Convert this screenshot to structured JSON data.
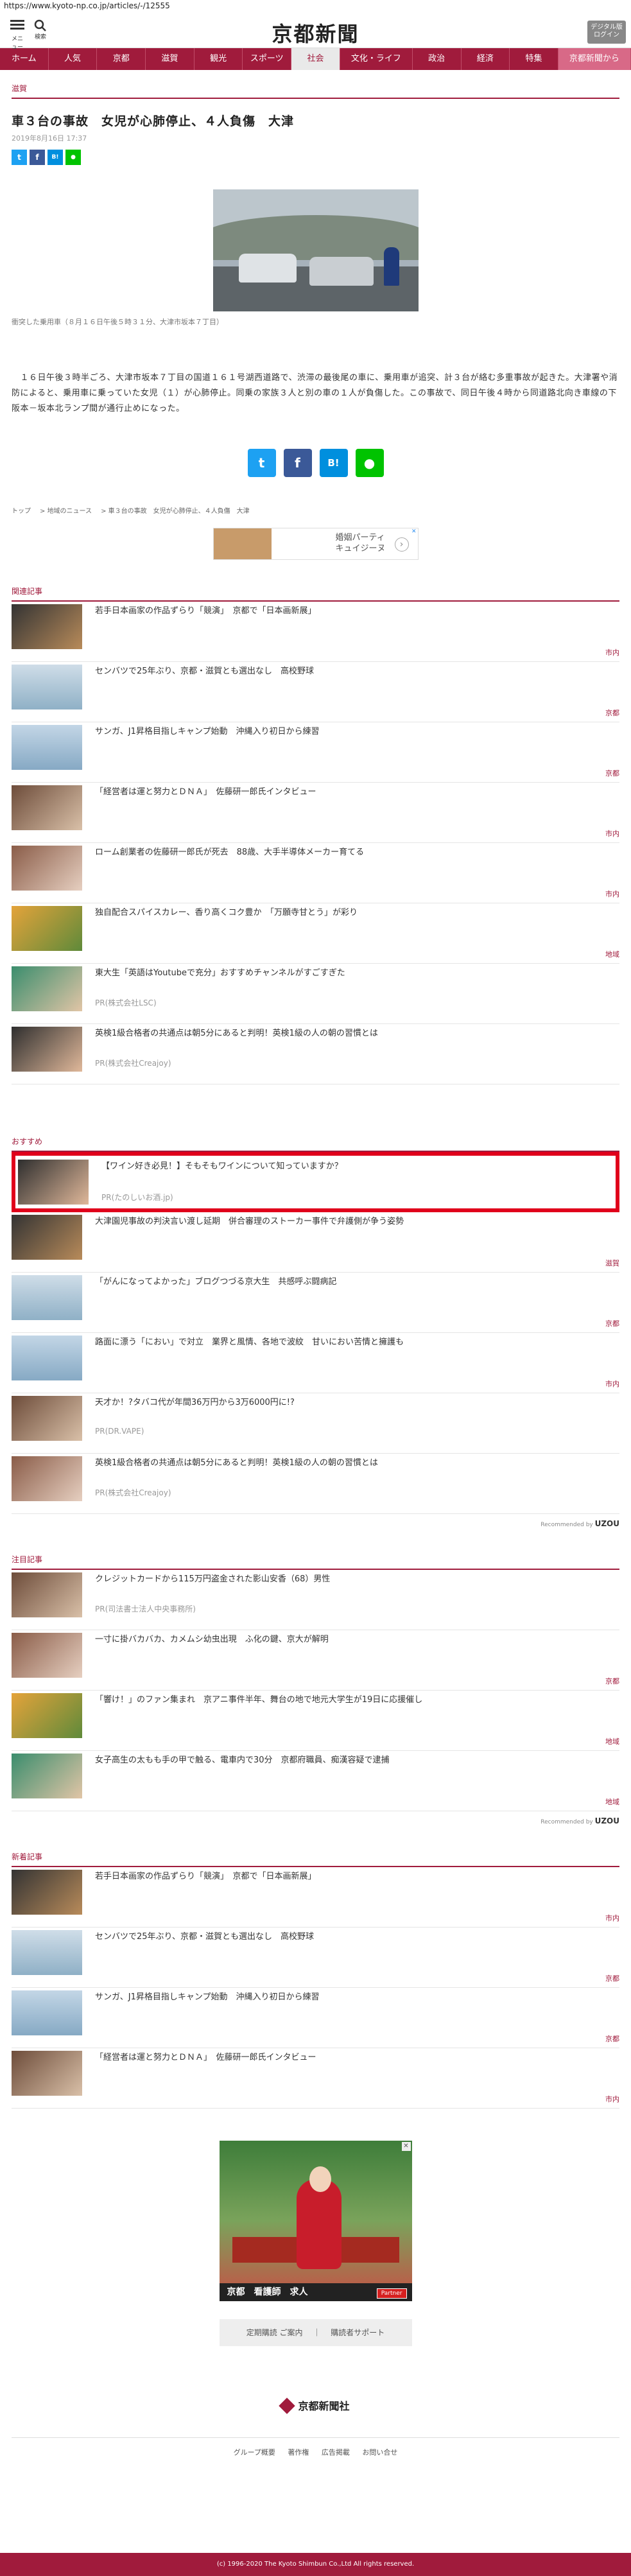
{
  "browser": {
    "url": "https://www.kyoto-np.co.jp/articles/-/12555"
  },
  "header": {
    "menu_label": "メニュー",
    "search_label": "検索",
    "logo": "京都新聞",
    "digital_btn": "デジタル版\nログイン"
  },
  "nav": [
    "ホーム",
    "人気",
    "京都",
    "滋賀",
    "観光",
    "スポーツ",
    "社会",
    "文化・ライフ",
    "政治",
    "経済",
    "特集",
    "京都新聞から"
  ],
  "article": {
    "section": "滋賀",
    "title": "車３台の事故　女児が心肺停止、４人負傷　大津",
    "date": "2019年8月16日 17:37",
    "caption": "衝突した乗用車（８月１６日午後５時３１分、大津市坂本７丁目）",
    "body": "　１６日午後３時半ごろ、大津市坂本７丁目の国道１６１号湖西道路で、渋滞の最後尾の車に、乗用車が追突、計３台が絡む多重事故が起きた。大津署や消防によると、乗用車に乗っていた女児（１）が心肺停止。同乗の家族３人と別の車の１人が負傷した。この事故で、同日午後４時から同道路北向き車線の下阪本－坂本北ランプ間が通行止めになった。"
  },
  "breadcrumb": [
    "トップ",
    "地域のニュース",
    "車３台の事故　女児が心肺停止、４人負傷　大津"
  ],
  "ad_small": {
    "text_line1": "婚姻パーティ",
    "text_line2": "キュイジーヌ"
  },
  "related": {
    "heading": "関連記事",
    "items": [
      {
        "title": "若手日本画家の作品ずらり「競演」　京都で「日本画新展」",
        "cat": "市内"
      },
      {
        "title": "センバツで25年ぶり、京都・滋賀とも選出なし　高校野球",
        "cat": "京都"
      },
      {
        "title": "サンガ、J1昇格目指しキャンプ始動　沖縄入り初日から練習",
        "cat": "京都"
      },
      {
        "title": "「経営者は運と努力とＤＮＡ」　佐藤研一郎氏インタビュー",
        "cat": "市内"
      },
      {
        "title": "ローム創業者の佐藤研一郎氏が死去　88歳、大手半導体メーカー育てる",
        "cat": "市内"
      },
      {
        "title": "独自配合スパイスカレー、香り高くコク豊か　「万願寺甘とう」が彩り",
        "cat": "地域"
      },
      {
        "title": "東大生「英語はYoutubeで充分」おすすめチャンネルがすごすぎた",
        "pr": "PR(株式会社LSC)"
      },
      {
        "title": "英検1級合格者の共通点は朝5分にあると判明！英検1級の人の朝の習慣とは",
        "pr": "PR(株式会社Creajoy)"
      }
    ]
  },
  "recommend": {
    "heading": "おすすめ",
    "items": [
      {
        "title": "【ワイン好き必見！】そもそもワインについて知っていますか？",
        "pr": "PR(たのしいお酒.jp)"
      },
      {
        "title": "大津園児事故の判決言い渡し延期　併合審理のストーカー事件で弁護側が争う姿勢",
        "cat": "滋賀"
      },
      {
        "title": "「がんになってよかった」ブログつづる京大生　共感呼ぶ闘病記",
        "cat": "京都"
      },
      {
        "title": "路面に漂う「におい」で対立　業界と風情、各地で波紋　甘いにおい苦情と擁護も",
        "cat": "市内"
      },
      {
        "title": "天才か！?タバコ代が年間36万円から3万6000円に!?",
        "pr": "PR(DR.VAPE)"
      },
      {
        "title": "英検1級合格者の共通点は朝5分にあると判明！英検1級の人の朝の習慣とは",
        "pr": "PR(株式会社Creajoy)"
      }
    ],
    "recommended_by": "Recommended by",
    "brand": "UZOU"
  },
  "notable": {
    "heading": "注目記事",
    "items": [
      {
        "title": "クレジットカードから115万円盗金された影山安香（68）男性",
        "pr": "PR(司法書士法人中央事務所)"
      },
      {
        "title": "一寸に掛バカバカ、カメムシ幼虫出現　ふ化の鍵、京大が解明",
        "cat": "京都"
      },
      {
        "title": "「響け！」のファン集まれ　京アニ事件半年、舞台の地で地元大学生が19日に応援催し",
        "cat": "地域"
      },
      {
        "title": "女子高生の太もも手の甲で触る、電車内で30分　京都府職員、痴漢容疑で逮捕",
        "cat": "地域"
      }
    ],
    "recommended_by": "Recommended by",
    "brand": "UZOU"
  },
  "latest": {
    "heading": "新着記事",
    "items": [
      {
        "title": "若手日本画家の作品ずらり「競演」　京都で「日本画新展」",
        "cat": "市内"
      },
      {
        "title": "センバツで25年ぶり、京都・滋賀とも選出なし　高校野球",
        "cat": "京都"
      },
      {
        "title": "サンガ、J1昇格目指しキャンプ始動　沖縄入り初日から練習",
        "cat": "京都"
      },
      {
        "title": "「経営者は運と努力とＤＮＡ」　佐藤研一郎氏インタビュー",
        "cat": "市内"
      }
    ]
  },
  "big_ad": {
    "banner": "京都　看護師　求人",
    "partner": "Partner"
  },
  "links_box": [
    "定期購読 ご案内",
    "｜",
    "購読者サポート"
  ],
  "footer": {
    "logo": "京都新聞社",
    "links": [
      "グループ概要",
      "著作権",
      "広告掲載",
      "お問い合せ"
    ],
    "copyright": "(c) 1996-2020 The Kyoto Shimbun Co.,Ltd All rights reserved."
  },
  "colors": {
    "brand": "#a01b3c",
    "highlight": "#e0001b"
  }
}
